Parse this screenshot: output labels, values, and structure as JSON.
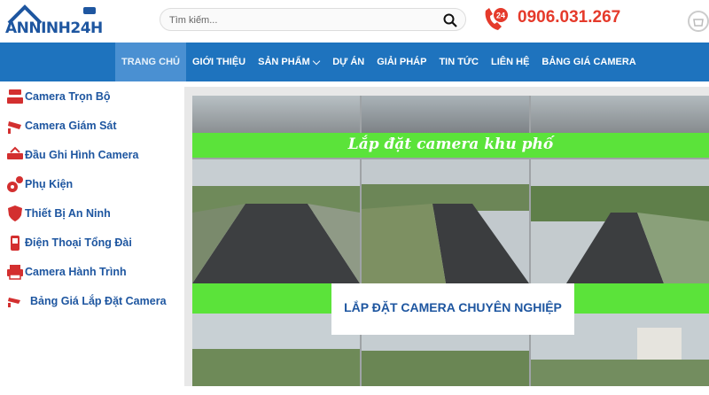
{
  "header": {
    "logo_text": "ANNINH24H",
    "search_placeholder": "Tìm kiếm...",
    "hotline_badge": "24",
    "phone": "0906.031.267"
  },
  "nav": {
    "items": [
      {
        "label": "TRANG CHỦ",
        "active": true
      },
      {
        "label": "GIỚI THIỆU"
      },
      {
        "label": "SẢN PHẨM ⌵"
      },
      {
        "label": "DỰ ÁN"
      },
      {
        "label": "GIẢI PHÁP"
      },
      {
        "label": "TIN TỨC"
      },
      {
        "label": "LIÊN HỆ"
      },
      {
        "label": "BẢNG GIÁ CAMERA"
      }
    ]
  },
  "sidebar": {
    "items": [
      {
        "label": "Camera Trọn Bộ",
        "icon": "camera-set-icon"
      },
      {
        "label": "Camera Giám Sát",
        "icon": "cctv-icon"
      },
      {
        "label": "Đầu Ghi Hình Camera",
        "icon": "recorder-icon"
      },
      {
        "label": "Phụ Kiện",
        "icon": "gear-icon"
      },
      {
        "label": "Thiết Bị An Ninh",
        "icon": "shield-icon"
      },
      {
        "label": "Điện Thoại Tổng Đài",
        "icon": "phone-icon"
      },
      {
        "label": "Camera Hành Trình",
        "icon": "printer-icon"
      },
      {
        "label": "Bảng Giá Lắp Đặt Camera",
        "icon": "cctv-icon"
      }
    ]
  },
  "banner": {
    "strip_text": "Lắp đặt camera khu phố",
    "caption": "LẮP ĐẶT CAMERA CHUYÊN NGHIỆP",
    "colors": {
      "strip": "#5be33a",
      "caption": "#1e56a0"
    }
  },
  "colors": {
    "nav": "#1e73be",
    "brand": "#1e56a0",
    "phone": "#e53a2b"
  }
}
